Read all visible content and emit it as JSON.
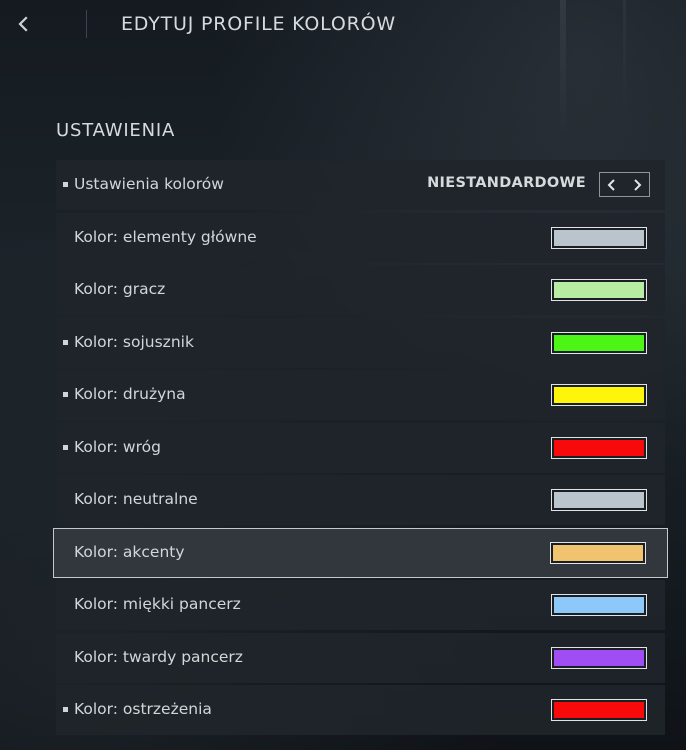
{
  "header": {
    "title": "EDYTUJ PROFILE KOLORÓW"
  },
  "section": {
    "title": "USTAWIENIA"
  },
  "preset": {
    "label": "Ustawienia kolorów",
    "value": "NIESTANDARDOWE"
  },
  "rows": [
    {
      "label": "Kolor: elementy główne",
      "color": "#b9c4cd",
      "modified": false
    },
    {
      "label": "Kolor: gracz",
      "color": "#b8eca3",
      "modified": false
    },
    {
      "label": "Kolor: sojusznik",
      "color": "#4cf515",
      "modified": true
    },
    {
      "label": "Kolor: drużyna",
      "color": "#fff50a",
      "modified": true
    },
    {
      "label": "Kolor: wróg",
      "color": "#f80a0a",
      "modified": true
    },
    {
      "label": "Kolor: neutralne",
      "color": "#b9c4cd",
      "modified": false
    },
    {
      "label": "Kolor: akcenty",
      "color": "#f1c36f",
      "modified": false
    },
    {
      "label": "Kolor: miękki pancerz",
      "color": "#8cc8f8",
      "modified": false
    },
    {
      "label": "Kolor: twardy pancerz",
      "color": "#a14df4",
      "modified": false
    },
    {
      "label": "Kolor: ostrzeżenia",
      "color": "#f80a0a",
      "modified": true
    }
  ],
  "selected_row": "Kolor: akcenty",
  "icons": {
    "back": "chevron-left-icon",
    "prev": "chevron-left-icon",
    "next": "chevron-right-icon"
  }
}
